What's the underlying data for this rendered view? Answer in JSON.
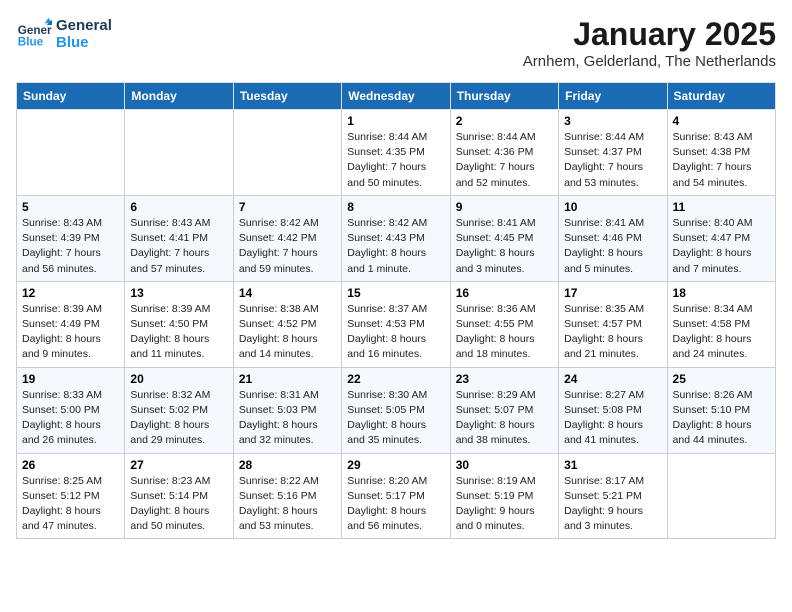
{
  "logo": {
    "line1": "General",
    "line2": "Blue"
  },
  "title": "January 2025",
  "subtitle": "Arnhem, Gelderland, The Netherlands",
  "headers": [
    "Sunday",
    "Monday",
    "Tuesday",
    "Wednesday",
    "Thursday",
    "Friday",
    "Saturday"
  ],
  "weeks": [
    [
      {
        "day": "",
        "info": ""
      },
      {
        "day": "",
        "info": ""
      },
      {
        "day": "",
        "info": ""
      },
      {
        "day": "1",
        "info": "Sunrise: 8:44 AM\nSunset: 4:35 PM\nDaylight: 7 hours\nand 50 minutes."
      },
      {
        "day": "2",
        "info": "Sunrise: 8:44 AM\nSunset: 4:36 PM\nDaylight: 7 hours\nand 52 minutes."
      },
      {
        "day": "3",
        "info": "Sunrise: 8:44 AM\nSunset: 4:37 PM\nDaylight: 7 hours\nand 53 minutes."
      },
      {
        "day": "4",
        "info": "Sunrise: 8:43 AM\nSunset: 4:38 PM\nDaylight: 7 hours\nand 54 minutes."
      }
    ],
    [
      {
        "day": "5",
        "info": "Sunrise: 8:43 AM\nSunset: 4:39 PM\nDaylight: 7 hours\nand 56 minutes."
      },
      {
        "day": "6",
        "info": "Sunrise: 8:43 AM\nSunset: 4:41 PM\nDaylight: 7 hours\nand 57 minutes."
      },
      {
        "day": "7",
        "info": "Sunrise: 8:42 AM\nSunset: 4:42 PM\nDaylight: 7 hours\nand 59 minutes."
      },
      {
        "day": "8",
        "info": "Sunrise: 8:42 AM\nSunset: 4:43 PM\nDaylight: 8 hours\nand 1 minute."
      },
      {
        "day": "9",
        "info": "Sunrise: 8:41 AM\nSunset: 4:45 PM\nDaylight: 8 hours\nand 3 minutes."
      },
      {
        "day": "10",
        "info": "Sunrise: 8:41 AM\nSunset: 4:46 PM\nDaylight: 8 hours\nand 5 minutes."
      },
      {
        "day": "11",
        "info": "Sunrise: 8:40 AM\nSunset: 4:47 PM\nDaylight: 8 hours\nand 7 minutes."
      }
    ],
    [
      {
        "day": "12",
        "info": "Sunrise: 8:39 AM\nSunset: 4:49 PM\nDaylight: 8 hours\nand 9 minutes."
      },
      {
        "day": "13",
        "info": "Sunrise: 8:39 AM\nSunset: 4:50 PM\nDaylight: 8 hours\nand 11 minutes."
      },
      {
        "day": "14",
        "info": "Sunrise: 8:38 AM\nSunset: 4:52 PM\nDaylight: 8 hours\nand 14 minutes."
      },
      {
        "day": "15",
        "info": "Sunrise: 8:37 AM\nSunset: 4:53 PM\nDaylight: 8 hours\nand 16 minutes."
      },
      {
        "day": "16",
        "info": "Sunrise: 8:36 AM\nSunset: 4:55 PM\nDaylight: 8 hours\nand 18 minutes."
      },
      {
        "day": "17",
        "info": "Sunrise: 8:35 AM\nSunset: 4:57 PM\nDaylight: 8 hours\nand 21 minutes."
      },
      {
        "day": "18",
        "info": "Sunrise: 8:34 AM\nSunset: 4:58 PM\nDaylight: 8 hours\nand 24 minutes."
      }
    ],
    [
      {
        "day": "19",
        "info": "Sunrise: 8:33 AM\nSunset: 5:00 PM\nDaylight: 8 hours\nand 26 minutes."
      },
      {
        "day": "20",
        "info": "Sunrise: 8:32 AM\nSunset: 5:02 PM\nDaylight: 8 hours\nand 29 minutes."
      },
      {
        "day": "21",
        "info": "Sunrise: 8:31 AM\nSunset: 5:03 PM\nDaylight: 8 hours\nand 32 minutes."
      },
      {
        "day": "22",
        "info": "Sunrise: 8:30 AM\nSunset: 5:05 PM\nDaylight: 8 hours\nand 35 minutes."
      },
      {
        "day": "23",
        "info": "Sunrise: 8:29 AM\nSunset: 5:07 PM\nDaylight: 8 hours\nand 38 minutes."
      },
      {
        "day": "24",
        "info": "Sunrise: 8:27 AM\nSunset: 5:08 PM\nDaylight: 8 hours\nand 41 minutes."
      },
      {
        "day": "25",
        "info": "Sunrise: 8:26 AM\nSunset: 5:10 PM\nDaylight: 8 hours\nand 44 minutes."
      }
    ],
    [
      {
        "day": "26",
        "info": "Sunrise: 8:25 AM\nSunset: 5:12 PM\nDaylight: 8 hours\nand 47 minutes."
      },
      {
        "day": "27",
        "info": "Sunrise: 8:23 AM\nSunset: 5:14 PM\nDaylight: 8 hours\nand 50 minutes."
      },
      {
        "day": "28",
        "info": "Sunrise: 8:22 AM\nSunset: 5:16 PM\nDaylight: 8 hours\nand 53 minutes."
      },
      {
        "day": "29",
        "info": "Sunrise: 8:20 AM\nSunset: 5:17 PM\nDaylight: 8 hours\nand 56 minutes."
      },
      {
        "day": "30",
        "info": "Sunrise: 8:19 AM\nSunset: 5:19 PM\nDaylight: 9 hours\nand 0 minutes."
      },
      {
        "day": "31",
        "info": "Sunrise: 8:17 AM\nSunset: 5:21 PM\nDaylight: 9 hours\nand 3 minutes."
      },
      {
        "day": "",
        "info": ""
      }
    ]
  ]
}
